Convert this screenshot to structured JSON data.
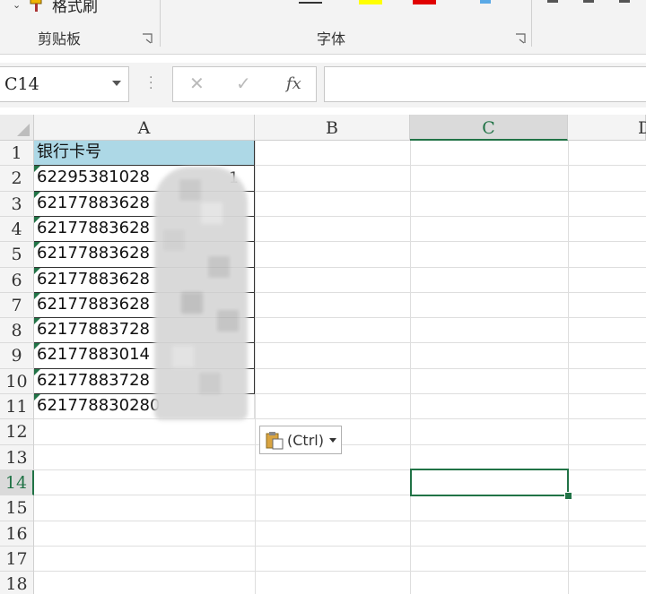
{
  "ribbon": {
    "format_painter_label": "格式刷",
    "groups": [
      {
        "label": "剪贴板"
      },
      {
        "label": "字体"
      }
    ]
  },
  "formula_bar": {
    "name_box": "C14",
    "cancel_icon": "✕",
    "enter_icon": "✓",
    "fx_label": "fx",
    "formula": ""
  },
  "sheet": {
    "columns": [
      "A",
      "B",
      "C",
      "D"
    ],
    "selected_column": "C",
    "rows": [
      "1",
      "2",
      "3",
      "4",
      "5",
      "6",
      "7",
      "8",
      "9",
      "10",
      "11",
      "12",
      "13",
      "14",
      "15",
      "16",
      "17",
      "18"
    ],
    "selected_row": "14",
    "selected_cell": "C14",
    "column_a_values": [
      "银行卡号",
      "62295381028",
      "62177883628",
      "62177883628",
      "62177883628",
      "62177883628",
      "62177883628",
      "62177883728",
      "62177883014",
      "62177883728",
      "621778830280"
    ],
    "row2_trailing_char": "1"
  },
  "paste_options": {
    "label": "(Ctrl)"
  },
  "colors": {
    "accent": "#217346",
    "header_fill": "#add8e6",
    "font_color_swatch": "#e00000",
    "highlight_swatch": "#ffff00"
  }
}
